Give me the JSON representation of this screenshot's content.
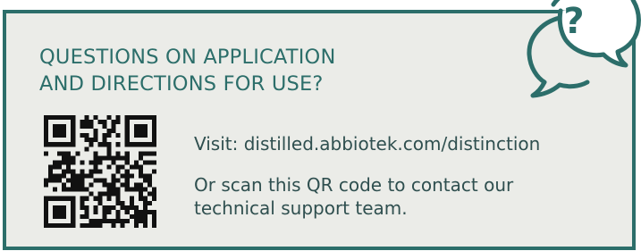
{
  "panel": {
    "heading_line1": "QUESTIONS ON APPLICATION",
    "heading_line2": "AND DIRECTIONS FOR USE?",
    "visit_text": "Visit: distilled.abbiotek.com/distinction",
    "scan_line1": "Or scan this QR code to contact our",
    "scan_line2": "technical support team.",
    "question_mark": "?"
  },
  "icons": {
    "qr": "qr-code-icon",
    "bubbles": "speech-bubbles-icon"
  },
  "colors": {
    "accent": "#2c6e6a",
    "panel_background": "#ebece8",
    "body_text": "#2f4f4f"
  }
}
